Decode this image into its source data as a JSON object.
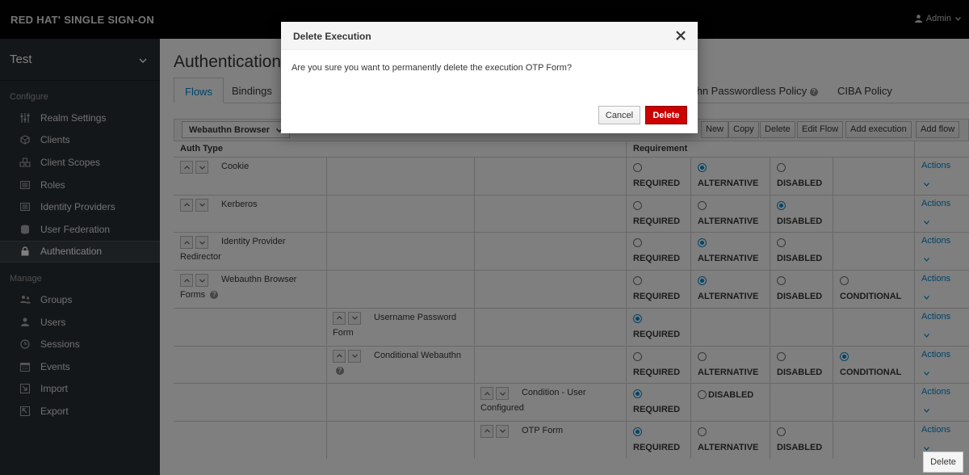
{
  "brand": "RED HAT' SINGLE SIGN-ON",
  "user_menu": {
    "label": "Admin"
  },
  "sidebar": {
    "realm": "Test",
    "configure_label": "Configure",
    "configure_items": [
      {
        "label": "Realm Settings",
        "icon": "sliders-icon"
      },
      {
        "label": "Clients",
        "icon": "cube-icon"
      },
      {
        "label": "Client Scopes",
        "icon": "cubes-icon"
      },
      {
        "label": "Roles",
        "icon": "list-icon"
      },
      {
        "label": "Identity Providers",
        "icon": "list-icon"
      },
      {
        "label": "User Federation",
        "icon": "database-icon"
      },
      {
        "label": "Authentication",
        "icon": "lock-icon",
        "active": true
      }
    ],
    "manage_label": "Manage",
    "manage_items": [
      {
        "label": "Groups",
        "icon": "users-icon"
      },
      {
        "label": "Users",
        "icon": "user-icon"
      },
      {
        "label": "Sessions",
        "icon": "clock-icon"
      },
      {
        "label": "Events",
        "icon": "calendar-icon"
      },
      {
        "label": "Import",
        "icon": "import-icon"
      },
      {
        "label": "Export",
        "icon": "export-icon"
      }
    ]
  },
  "page": {
    "title": "Authentication",
    "tabs": [
      "Flows",
      "Bindings",
      "thn Passwordless Policy",
      "CIBA Policy"
    ],
    "active_tab": "Flows"
  },
  "toolbar": {
    "selected_flow": "Webauthn Browser",
    "buttons": [
      "New",
      "Copy",
      "Delete",
      "Edit Flow",
      "Add execution",
      "Add flow"
    ]
  },
  "table": {
    "col_auth_type": "Auth Type",
    "col_requirement": "Requirement",
    "actions_label": "Actions",
    "rows": [
      {
        "name": "Cookie",
        "name2": "",
        "level": 0,
        "help": false,
        "options": [
          "REQUIRED",
          "ALTERNATIVE",
          "DISABLED"
        ],
        "selected": "ALTERNATIVE"
      },
      {
        "name": "Kerberos",
        "name2": "",
        "level": 0,
        "help": false,
        "options": [
          "REQUIRED",
          "ALTERNATIVE",
          "DISABLED"
        ],
        "selected": "DISABLED"
      },
      {
        "name": "Identity Provider",
        "name2": "Redirector",
        "level": 0,
        "help": false,
        "options": [
          "REQUIRED",
          "ALTERNATIVE",
          "DISABLED"
        ],
        "selected": "ALTERNATIVE"
      },
      {
        "name": "Webauthn Browser",
        "name2": "Forms",
        "level": 0,
        "help": true,
        "options": [
          "REQUIRED",
          "ALTERNATIVE",
          "DISABLED",
          "CONDITIONAL"
        ],
        "selected": "ALTERNATIVE"
      },
      {
        "name": "Username Password",
        "name2": "Form",
        "level": 1,
        "help": false,
        "options": [
          "REQUIRED"
        ],
        "selected": "REQUIRED"
      },
      {
        "name": "Conditional Webauthn",
        "name2": "",
        "level": 1,
        "help": true,
        "options": [
          "REQUIRED",
          "ALTERNATIVE",
          "DISABLED",
          "CONDITIONAL"
        ],
        "selected": "CONDITIONAL"
      },
      {
        "name": "Condition - User",
        "name2": "Configured",
        "level": 2,
        "help": false,
        "options": [
          "REQUIRED",
          "DISABLED"
        ],
        "selected": "REQUIRED",
        "inline_second": true
      },
      {
        "name": "OTP Form",
        "name2": "",
        "level": 2,
        "help": false,
        "options": [
          "REQUIRED",
          "ALTERNATIVE",
          "DISABLED"
        ],
        "selected": "REQUIRED"
      }
    ]
  },
  "modal": {
    "title": "Delete Execution",
    "message": "Are you sure you want to permanently delete the execution OTP Form?",
    "cancel_label": "Cancel",
    "delete_label": "Delete"
  },
  "tooltip": {
    "label": "Delete"
  },
  "colors": {
    "accent": "#0088ce",
    "danger": "#cc0000",
    "topbar": "#030303",
    "sidebar": "#292e34"
  }
}
